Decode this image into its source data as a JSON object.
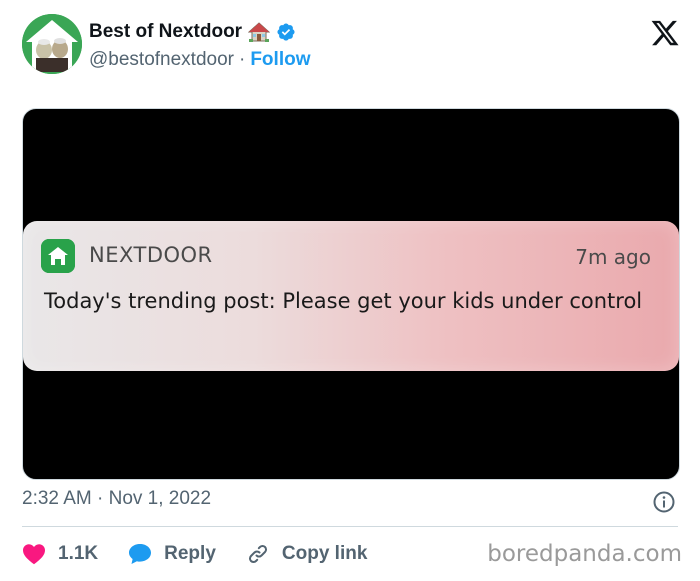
{
  "account": {
    "display_name": "Best of Nextdoor",
    "handle": "@bestofnextdoor",
    "separator": "·",
    "follow_label": "Follow"
  },
  "media": {
    "notification": {
      "app_name": "NEXTDOOR",
      "time_ago": "7m ago",
      "body": "Today's trending post: Please get your kids under control"
    }
  },
  "timestamp": {
    "text": "2:32 AM · Nov 1, 2022"
  },
  "actions": {
    "likes": "1.1K",
    "reply_label": "Reply",
    "copy_link_label": "Copy link"
  },
  "watermark": "boredpanda.com",
  "icons": {
    "brand": "x-logo-icon",
    "verified": "verified-badge-icon",
    "house": "house-emoji-icon",
    "heart": "heart-icon",
    "reply": "reply-bubble-icon",
    "link": "link-icon",
    "info": "info-icon",
    "app": "nextdoor-app-icon"
  },
  "colors": {
    "accent": "#1d9bf0",
    "heart": "#f91880",
    "nextdoor_green": "#29a24a",
    "text_secondary": "#536471"
  }
}
